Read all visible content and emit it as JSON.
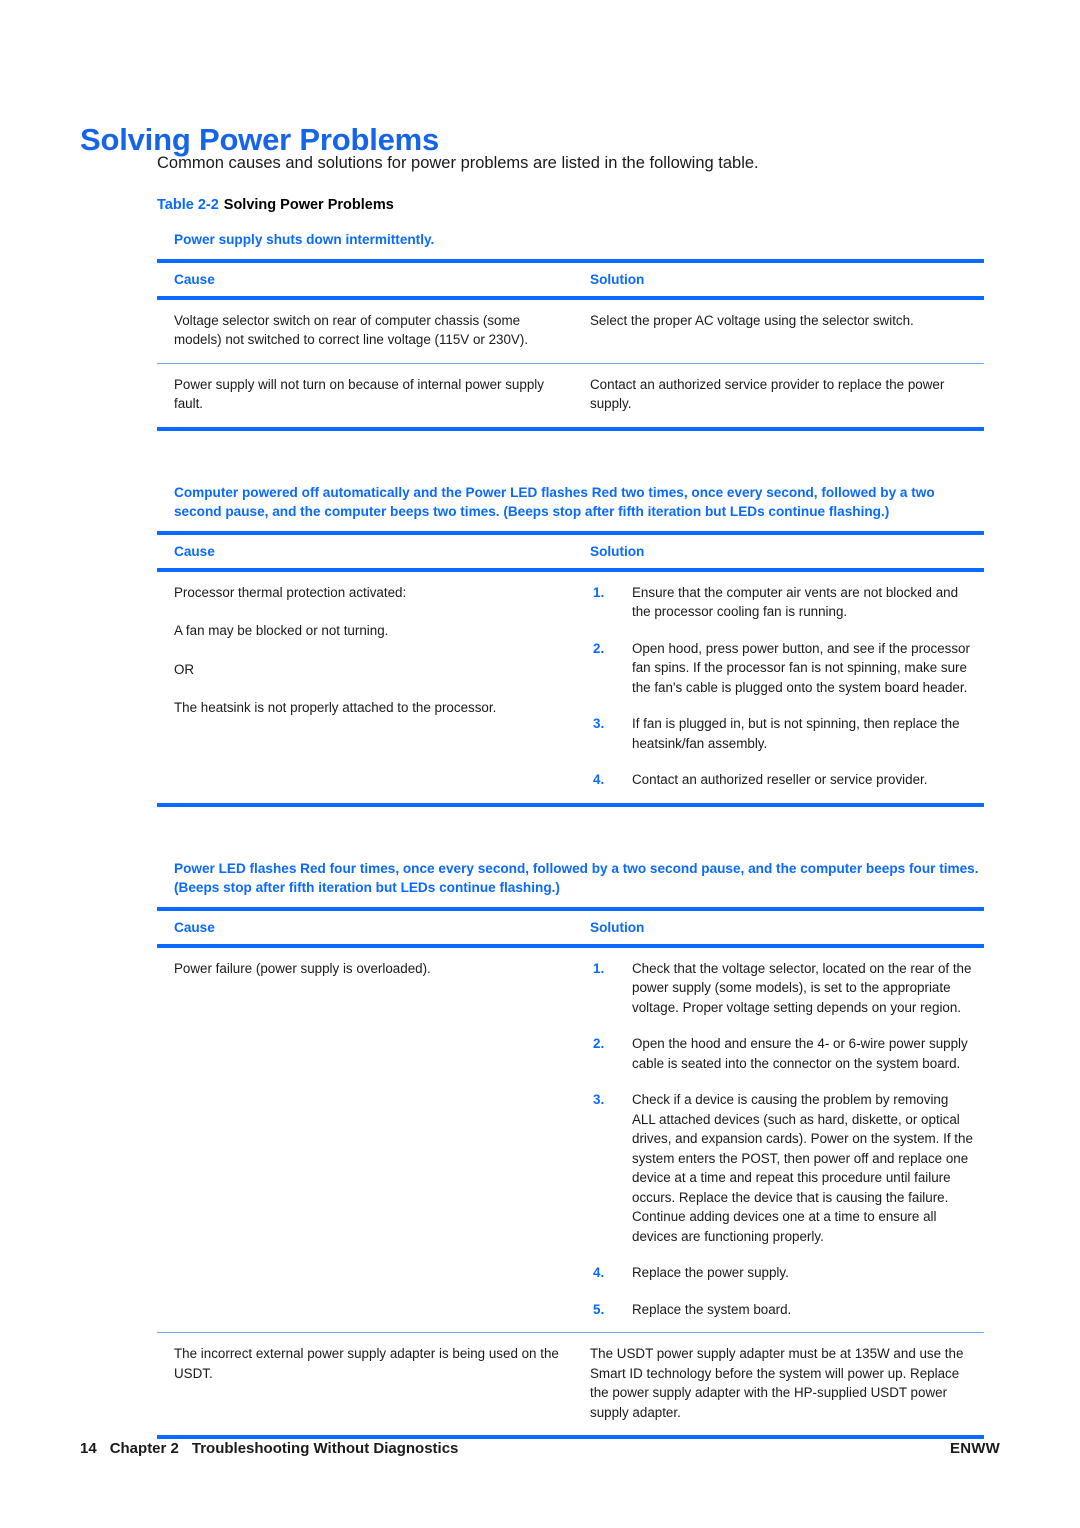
{
  "page": {
    "title": "Solving Power Problems",
    "intro": "Common causes and solutions for power problems are listed in the following table.",
    "caption_number": "Table 2-2",
    "caption_title": "Solving Power Problems",
    "accent_color": "#0a6aff",
    "text_color": "#1a1a1a"
  },
  "columns": {
    "cause": "Cause",
    "solution": "Solution"
  },
  "tables": [
    {
      "banner": "Power supply shuts down intermittently.",
      "rows": [
        {
          "cause": [
            "Voltage selector switch on rear of computer chassis (some models) not switched to correct line voltage (115V or 230V)."
          ],
          "solution_text": "Select the proper AC voltage using the selector switch.",
          "solution_list": []
        },
        {
          "cause": [
            "Power supply will not turn on because of internal power supply fault."
          ],
          "solution_text": "Contact an authorized service provider to replace the power supply.",
          "solution_list": []
        }
      ]
    },
    {
      "banner": "Computer powered off automatically and the Power LED flashes Red two times, once every second, followed by a two second pause, and the computer beeps two times. (Beeps stop after fifth iteration but LEDs continue flashing.)",
      "rows": [
        {
          "cause": [
            "Processor thermal protection activated:",
            "A fan may be blocked or not turning.",
            "OR",
            "The heatsink is not properly attached to the processor."
          ],
          "solution_text": "",
          "solution_list": [
            {
              "marker": "1.",
              "text": "Ensure that the computer air vents are not blocked and the processor cooling fan is running."
            },
            {
              "marker": "2.",
              "text": "Open hood, press power button, and see if the processor fan spins. If the processor fan is not spinning, make sure the fan's cable is plugged onto the system board header."
            },
            {
              "marker": "3.",
              "text": "If fan is plugged in, but is not spinning, then replace the heatsink/fan assembly."
            },
            {
              "marker": "4.",
              "text": "Contact an authorized reseller or service provider."
            }
          ]
        }
      ]
    },
    {
      "banner": "Power LED flashes Red four times, once every second, followed by a two second pause, and the computer beeps four times. (Beeps stop after fifth iteration but LEDs continue flashing.)",
      "rows": [
        {
          "cause": [
            "Power failure (power supply is overloaded)."
          ],
          "solution_text": "",
          "solution_list": [
            {
              "marker": "1.",
              "text": "Check that the voltage selector, located on the rear of the power supply (some models), is set to the appropriate voltage. Proper voltage setting depends on your region."
            },
            {
              "marker": "2.",
              "text": "Open the hood and ensure the 4- or 6-wire power supply cable is seated into the connector on the system board."
            },
            {
              "marker": "3.",
              "text": "Check if a device is causing the problem by removing ALL attached devices (such as hard, diskette, or optical drives, and expansion cards). Power on the system. If the system enters the POST, then power off and replace one device at a time and repeat this procedure until failure occurs. Replace the device that is causing the failure. Continue adding devices one at a time to ensure all devices are functioning properly."
            },
            {
              "marker": "4.",
              "text": "Replace the power supply."
            },
            {
              "marker": "5.",
              "text": "Replace the system board."
            }
          ]
        },
        {
          "cause": [
            "The incorrect external power supply adapter is being used on the USDT."
          ],
          "solution_text": "The USDT power supply adapter must be at 135W and use the Smart ID technology before the system will power up. Replace the power supply adapter with the HP-supplied USDT power supply adapter.",
          "solution_list": []
        }
      ]
    }
  ],
  "footer": {
    "page_number": "14",
    "chapter": "Chapter 2",
    "chapter_title": "Troubleshooting Without Diagnostics",
    "right": "ENWW"
  }
}
